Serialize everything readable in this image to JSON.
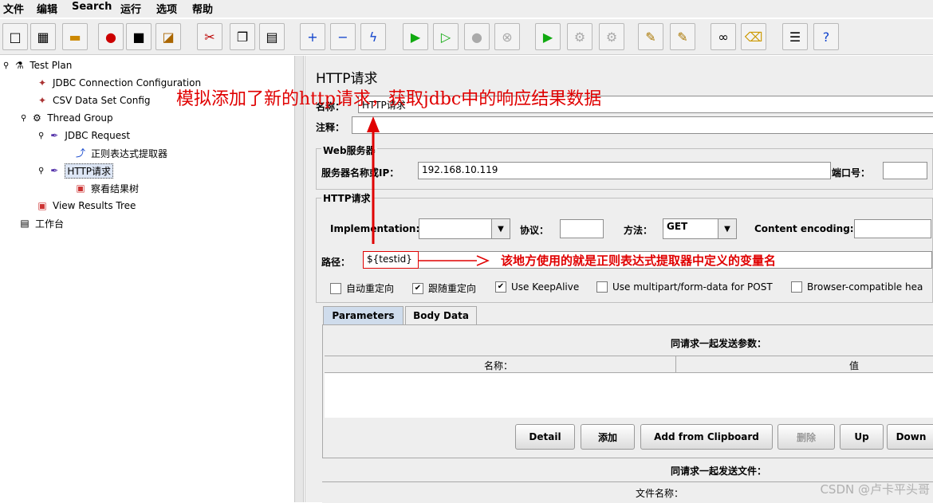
{
  "menu": [
    "文件",
    "编辑",
    "Search",
    "运行",
    "选项",
    "帮助"
  ],
  "toolbar_icons": [
    "new-icon",
    "templates-icon",
    "open-icon",
    "close-icon",
    "save-icon",
    "save-as-icon",
    "cut-icon",
    "copy-icon",
    "paste-icon",
    "expand-icon",
    "collapse-icon",
    "toggle-icon",
    "start-icon",
    "start-no-pause-icon",
    "stop-icon",
    "shutdown-icon",
    "remote-start-icon",
    "remote-stop-icon",
    "remote-shutdown-icon",
    "clear-icon",
    "clear-all-icon",
    "search-icon",
    "reset-search-icon",
    "function-helper-icon",
    "help-icon"
  ],
  "tree": [
    {
      "label": "Test Plan",
      "icon": "test-plan-icon"
    },
    {
      "label": "JDBC Connection Configuration",
      "icon": "config-icon"
    },
    {
      "label": "CSV Data Set Config",
      "icon": "config-icon"
    },
    {
      "label": "Thread Group",
      "icon": "thread-group-icon"
    },
    {
      "label": "JDBC Request",
      "icon": "sampler-icon"
    },
    {
      "label": "正则表达式提取器",
      "icon": "extractor-icon"
    },
    {
      "label": "HTTP请求",
      "icon": "sampler-icon"
    },
    {
      "label": "察看结果树",
      "icon": "listener-icon"
    },
    {
      "label": "View Results Tree",
      "icon": "listener-icon"
    },
    {
      "label": "工作台",
      "icon": "workbench-icon"
    }
  ],
  "panel": {
    "title": "HTTP请求",
    "name_label": "名称：",
    "name_value": "HTTP请求",
    "comment_label": "注释：",
    "comment_value": "",
    "web_server_group": "Web服务器",
    "server_label": "服务器名称或IP：",
    "server_value": "192.168.10.119",
    "port_label": "端口号：",
    "port_value": "",
    "http_group": "HTTP请求",
    "impl_label": "Implementation:",
    "impl_value": "",
    "protocol_label": "协议：",
    "protocol_value": "",
    "method_label": "方法：",
    "method_value": "GET",
    "encoding_label": "Content encoding:",
    "encoding_value": "",
    "path_label": "路径：",
    "path_value": "${testid}",
    "checkboxes": [
      {
        "label": "自动重定向",
        "checked": false
      },
      {
        "label": "跟随重定向",
        "checked": true
      },
      {
        "label": "Use KeepAlive",
        "checked": true
      },
      {
        "label": "Use multipart/form-data for POST",
        "checked": false
      },
      {
        "label": "Browser-compatible hea",
        "checked": false
      }
    ],
    "tabs": [
      "Parameters",
      "Body Data"
    ],
    "params_title": "同请求一起发送参数：",
    "col_name": "名称：",
    "col_value": "值",
    "buttons": [
      "Detail",
      "添加",
      "Add from Clipboard",
      "删除",
      "Up",
      "Down"
    ],
    "files_title": "同请求一起发送文件：",
    "file_col": "文件名称："
  },
  "annotations": {
    "top": "模拟添加了新的http请求，获取jdbc中的响应结果数据",
    "path_note": "该地方使用的就是正则表达式提取器中定义的变量名"
  },
  "watermark": "CSDN @卢卡平头哥"
}
